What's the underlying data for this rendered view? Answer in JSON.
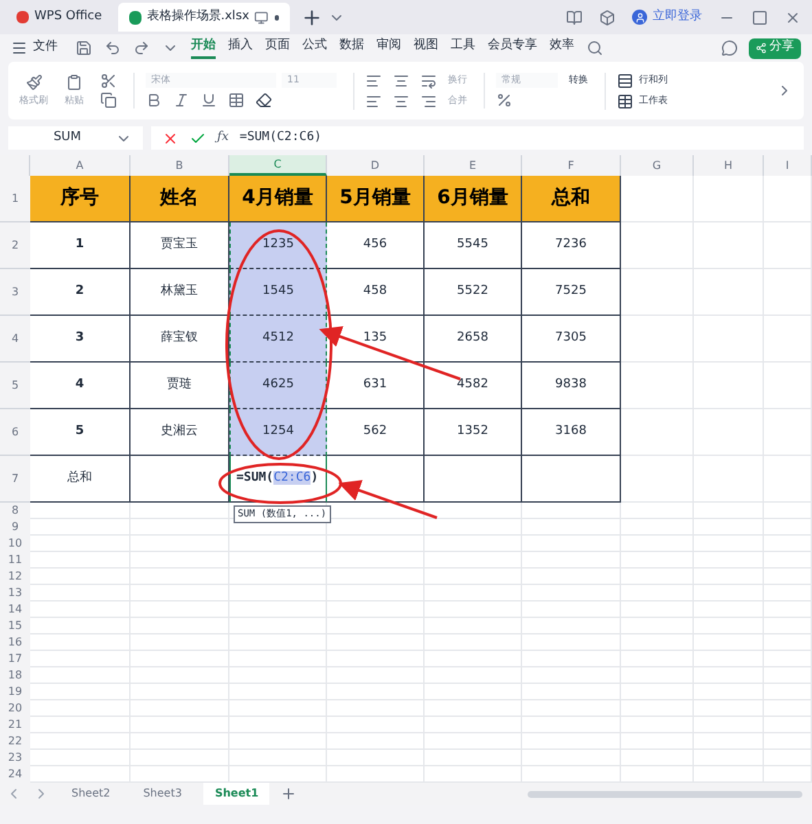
{
  "title_bar": {
    "app_tab": "WPS Office",
    "file_tab": "表格操作场景.xlsx",
    "login": "立即登录"
  },
  "menu": {
    "file": "文件",
    "tabs": [
      {
        "label": "开始",
        "selected": true
      },
      {
        "label": "插入",
        "selected": false
      },
      {
        "label": "页面",
        "selected": false
      },
      {
        "label": "公式",
        "selected": false
      },
      {
        "label": "数据",
        "selected": false
      },
      {
        "label": "审阅",
        "selected": false
      },
      {
        "label": "视图",
        "selected": false
      },
      {
        "label": "工具",
        "selected": false
      },
      {
        "label": "会员专享",
        "selected": false
      },
      {
        "label": "效率",
        "selected": false
      }
    ],
    "share": "分享"
  },
  "ribbon": {
    "format_painter": "格式刷",
    "paste": "粘贴",
    "font": "宋体",
    "size": "11",
    "wrap": "换行",
    "merge": "合并",
    "number_format": "常规",
    "convert": "转换",
    "rows_cols": "行和列",
    "worksheet": "工作表"
  },
  "formula_bar": {
    "name_box": "SUM",
    "function_label": "ƒx",
    "formula": "=SUM(C2:C6)"
  },
  "grid": {
    "columns": [
      {
        "label": "A",
        "selected": false
      },
      {
        "label": "B",
        "selected": false
      },
      {
        "label": "C",
        "selected": true
      },
      {
        "label": "D",
        "selected": false
      },
      {
        "label": "E",
        "selected": false
      },
      {
        "label": "F",
        "selected": false
      },
      {
        "label": "G",
        "selected": false
      },
      {
        "label": "H",
        "selected": false
      },
      {
        "label": "I",
        "selected": false
      }
    ],
    "rows": [
      {
        "header": "1",
        "kind": "header",
        "in_range": false,
        "cells": [
          "序号",
          "姓名",
          "4月销量",
          "5月销量",
          "6月销量",
          "总和"
        ]
      },
      {
        "header": "2",
        "kind": "data",
        "in_range": true,
        "cells": [
          "1",
          "贾宝玉",
          "1235",
          "456",
          "5545",
          "7236"
        ]
      },
      {
        "header": "3",
        "kind": "data",
        "in_range": true,
        "cells": [
          "2",
          "林黛玉",
          "1545",
          "458",
          "5522",
          "7525"
        ]
      },
      {
        "header": "4",
        "kind": "data",
        "in_range": true,
        "cells": [
          "3",
          "薛宝钗",
          "4512",
          "135",
          "2658",
          "7305"
        ]
      },
      {
        "header": "5",
        "kind": "data",
        "in_range": true,
        "cells": [
          "4",
          "贾琏",
          "4625",
          "631",
          "4582",
          "9838"
        ]
      },
      {
        "header": "6",
        "kind": "data",
        "in_range": true,
        "cells": [
          "5",
          "史湘云",
          "1254",
          "562",
          "1352",
          "3168"
        ]
      },
      {
        "header": "7",
        "kind": "total",
        "in_range": false,
        "cells": [
          "总和",
          "",
          "",
          "",
          "",
          ""
        ],
        "editing": {
          "prefix": "=SUM(",
          "ref": "C2:C6",
          "suffix": ")",
          "hint": "SUM (数值1, ...)"
        }
      }
    ],
    "empty_rows": [
      "8",
      "9",
      "10",
      "11",
      "12",
      "13",
      "14",
      "15",
      "16",
      "17",
      "18",
      "19",
      "20",
      "21",
      "22",
      "23",
      "24"
    ]
  },
  "sheet_tabs": [
    {
      "label": "Sheet2",
      "selected": false
    },
    {
      "label": "Sheet3",
      "selected": false
    },
    {
      "label": "Sheet1",
      "selected": true
    }
  ]
}
